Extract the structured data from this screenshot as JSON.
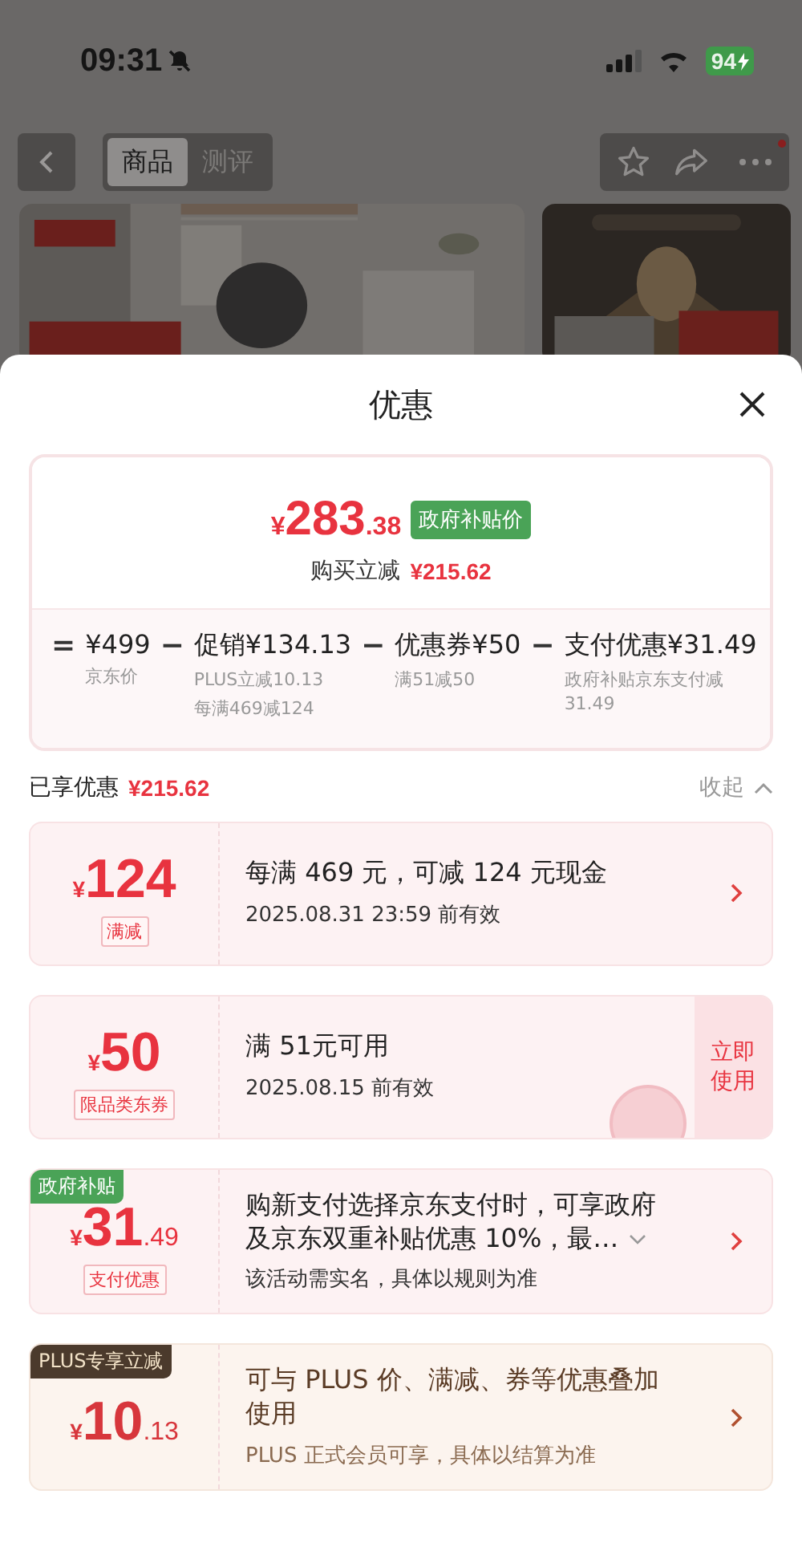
{
  "status_bar": {
    "time": "09:31",
    "muted": true,
    "battery": "94",
    "charging": true
  },
  "nav": {
    "tabs": [
      {
        "label": "商品",
        "selected": true
      },
      {
        "label": "测评",
        "selected": false
      }
    ],
    "more_badge": true
  },
  "sheet": {
    "title": "优惠"
  },
  "summary": {
    "price": {
      "currency": "¥",
      "integer": "283",
      "decimal": ".38"
    },
    "price_tag": "政府补贴价",
    "saving_label": "购买立减",
    "saving_amount": "¥215.62",
    "breakdown": [
      {
        "op": "=",
        "amount": "¥499",
        "notes": [
          "京东价"
        ]
      },
      {
        "op": "−",
        "amount": "促销¥134.13",
        "notes": [
          "PLUS立减10.13",
          "每满469减124"
        ]
      },
      {
        "op": "−",
        "amount": "优惠券¥50",
        "notes": [
          "满51减50"
        ]
      },
      {
        "op": "−",
        "amount": "支付优惠¥31.49",
        "notes": [
          "政府补贴京东支付减31.49"
        ]
      }
    ]
  },
  "enjoyed": {
    "label": "已享优惠",
    "amount": "¥215.62",
    "toggle": "收起",
    "expanded": true
  },
  "coupons": [
    {
      "kind": "red",
      "currency": "¥",
      "integer": "124",
      "tag": "满减",
      "title": "每满 469 元，可减 124 元现金",
      "note": "2025.08.31 23:59 前有效",
      "action": {
        "kind": "chevron"
      }
    },
    {
      "kind": "red",
      "currency": "¥",
      "integer": "50",
      "tag": "限品类东券",
      "title": "满 51元可用",
      "note": "2025.08.15 前有效",
      "action": {
        "kind": "button",
        "label": "立即使用"
      },
      "stamp": true
    },
    {
      "kind": "red",
      "badge": {
        "kind": "gov",
        "text": "政府补贴"
      },
      "currency": "¥",
      "integer": "31",
      "decimal": ".49",
      "tag": "支付优惠",
      "title": "购新支付选择京东支付时，可享政府及京东双重补贴优惠 10%，最…",
      "expandable": true,
      "note": "该活动需实名，具体以规则为准",
      "action": {
        "kind": "chevron"
      }
    },
    {
      "kind": "plus",
      "badge": {
        "kind": "plus",
        "text": "PLUS专享立减"
      },
      "currency": "¥",
      "integer": "10",
      "decimal": ".13",
      "title": "可与 PLUS 价、满减、券等优惠叠加使用",
      "note": "PLUS 正式会员可享，具体以结算为准",
      "action": {
        "kind": "chevron"
      }
    }
  ]
}
